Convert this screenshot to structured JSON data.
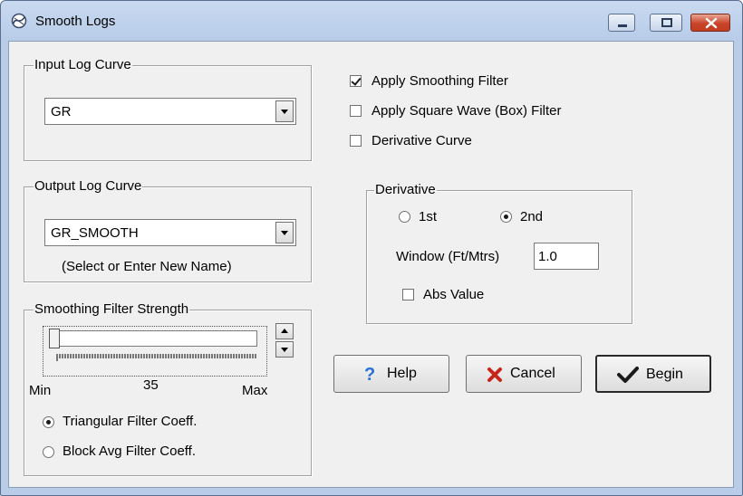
{
  "window": {
    "title": "Smooth Logs"
  },
  "icons": {
    "app": "smooth-logs-icon",
    "minimize": "minimize-icon",
    "maximize": "maximize-icon",
    "close": "close-icon",
    "help": "question-mark-icon",
    "cancel": "red-x-icon",
    "begin": "checkmark-icon"
  },
  "input_group": {
    "label": "Input Log Curve",
    "value": "GR"
  },
  "output_group": {
    "label": "Output Log Curve",
    "value": "GR_SMOOTH",
    "hint": "(Select or Enter New Name)"
  },
  "filters": {
    "apply_smoothing": {
      "label": "Apply Smoothing Filter",
      "checked": true
    },
    "apply_square": {
      "label": "Apply Square Wave (Box) Filter",
      "checked": false
    },
    "derivative_curve": {
      "label": "Derivative Curve",
      "checked": false
    }
  },
  "derivative": {
    "label": "Derivative",
    "first": {
      "label": "1st",
      "selected": false
    },
    "second": {
      "label": "2nd",
      "selected": true
    },
    "window_label": "Window (Ft/Mtrs)",
    "window_value": "1.0",
    "abs_value": {
      "label": "Abs Value",
      "checked": false
    }
  },
  "strength": {
    "label": "Smoothing Filter Strength",
    "min_label": "Min",
    "max_label": "Max",
    "value": "35",
    "triangular": {
      "label": "Triangular Filter Coeff.",
      "selected": true
    },
    "block": {
      "label": "Block Avg Filter Coeff.",
      "selected": false
    }
  },
  "buttons": {
    "help": "Help",
    "cancel": "Cancel",
    "begin": "Begin"
  }
}
